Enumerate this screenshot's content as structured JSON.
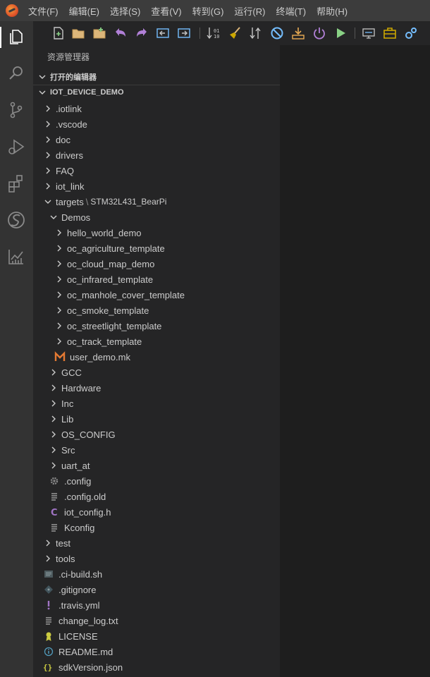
{
  "menu": [
    "文件(F)",
    "编辑(E)",
    "选择(S)",
    "查看(V)",
    "转到(G)",
    "运行(R)",
    "终端(T)",
    "帮助(H)"
  ],
  "activity_icons": [
    "explorer-icon",
    "search-icon",
    "source-control-icon",
    "run-debug-icon",
    "extensions-icon",
    "iot-studio-icon",
    "chart-icon"
  ],
  "toolbar_icons": [
    "new-file-icon",
    "open-folder-icon",
    "new-project-icon",
    "undo-icon",
    "redo-icon",
    "back-icon",
    "forward-icon",
    "compile-icon",
    "clean-icon",
    "rebuild-icon",
    "stop-icon",
    "download-icon",
    "power-icon",
    "run-icon",
    "serial-icon",
    "toolbox-icon",
    "settings-icon"
  ],
  "explorer": {
    "title": "资源管理器",
    "open_editors": "打开的编辑器",
    "project": "IOT_DEVICE_DEMO"
  },
  "tree": [
    {
      "label": "iotlink",
      "prefix": ".",
      "depth": 0,
      "type": "folder"
    },
    {
      "label": ".vscode",
      "depth": 0,
      "type": "folder"
    },
    {
      "label": "doc",
      "depth": 0,
      "type": "folder"
    },
    {
      "label": "drivers",
      "depth": 0,
      "type": "folder"
    },
    {
      "label": "FAQ",
      "depth": 0,
      "type": "folder"
    },
    {
      "label": "iot_link",
      "depth": 0,
      "type": "folder"
    },
    {
      "label": "targets",
      "sub": "STM32L431_BearPi",
      "depth": 0,
      "type": "folder-open"
    },
    {
      "label": "Demos",
      "depth": 1,
      "type": "folder-open"
    },
    {
      "label": "hello_world_demo",
      "depth": 2,
      "type": "folder"
    },
    {
      "label": "oc_agriculture_template",
      "depth": 2,
      "type": "folder"
    },
    {
      "label": "oc_cloud_map_demo",
      "depth": 2,
      "type": "folder"
    },
    {
      "label": "oc_infrared_template",
      "depth": 2,
      "type": "folder"
    },
    {
      "label": "oc_manhole_cover_template",
      "depth": 2,
      "type": "folder"
    },
    {
      "label": "oc_smoke_template",
      "depth": 2,
      "type": "folder"
    },
    {
      "label": "oc_streetlight_template",
      "depth": 2,
      "type": "folder"
    },
    {
      "label": "oc_track_template",
      "depth": 2,
      "type": "folder"
    },
    {
      "label": "user_demo.mk",
      "depth": 2,
      "type": "file",
      "icon": "makefile-icon"
    },
    {
      "label": "GCC",
      "depth": 1,
      "type": "folder"
    },
    {
      "label": "Hardware",
      "depth": 1,
      "type": "folder"
    },
    {
      "label": "Inc",
      "depth": 1,
      "type": "folder"
    },
    {
      "label": "Lib",
      "depth": 1,
      "type": "folder"
    },
    {
      "label": "OS_CONFIG",
      "depth": 1,
      "type": "folder"
    },
    {
      "label": "Src",
      "depth": 1,
      "type": "folder"
    },
    {
      "label": "uart_at",
      "depth": 1,
      "type": "folder"
    },
    {
      "label": ".config",
      "depth": 1,
      "type": "file",
      "icon": "gear-file-icon"
    },
    {
      "label": ".config.old",
      "depth": 1,
      "type": "file",
      "icon": "text-file-icon"
    },
    {
      "label": "iot_config.h",
      "depth": 1,
      "type": "file",
      "icon": "c-header-icon"
    },
    {
      "label": "Kconfig",
      "depth": 1,
      "type": "file",
      "icon": "text-file-icon"
    },
    {
      "label": "test",
      "depth": 0,
      "type": "folder"
    },
    {
      "label": "tools",
      "depth": 0,
      "type": "folder"
    },
    {
      "label": ".ci-build.sh",
      "depth": 0,
      "type": "file",
      "icon": "shell-file-icon"
    },
    {
      "label": ".gitignore",
      "depth": 0,
      "type": "file",
      "icon": "git-file-icon"
    },
    {
      "label": ".travis.yml",
      "depth": 0,
      "type": "file",
      "icon": "yaml-file-icon"
    },
    {
      "label": "change_log.txt",
      "depth": 0,
      "type": "file",
      "icon": "text-file-icon"
    },
    {
      "label": "LICENSE",
      "depth": 0,
      "type": "file",
      "icon": "license-file-icon"
    },
    {
      "label": "README.md",
      "depth": 0,
      "type": "file",
      "icon": "info-file-icon"
    },
    {
      "label": "sdkVersion.json",
      "depth": 0,
      "type": "file",
      "icon": "json-file-icon"
    }
  ]
}
